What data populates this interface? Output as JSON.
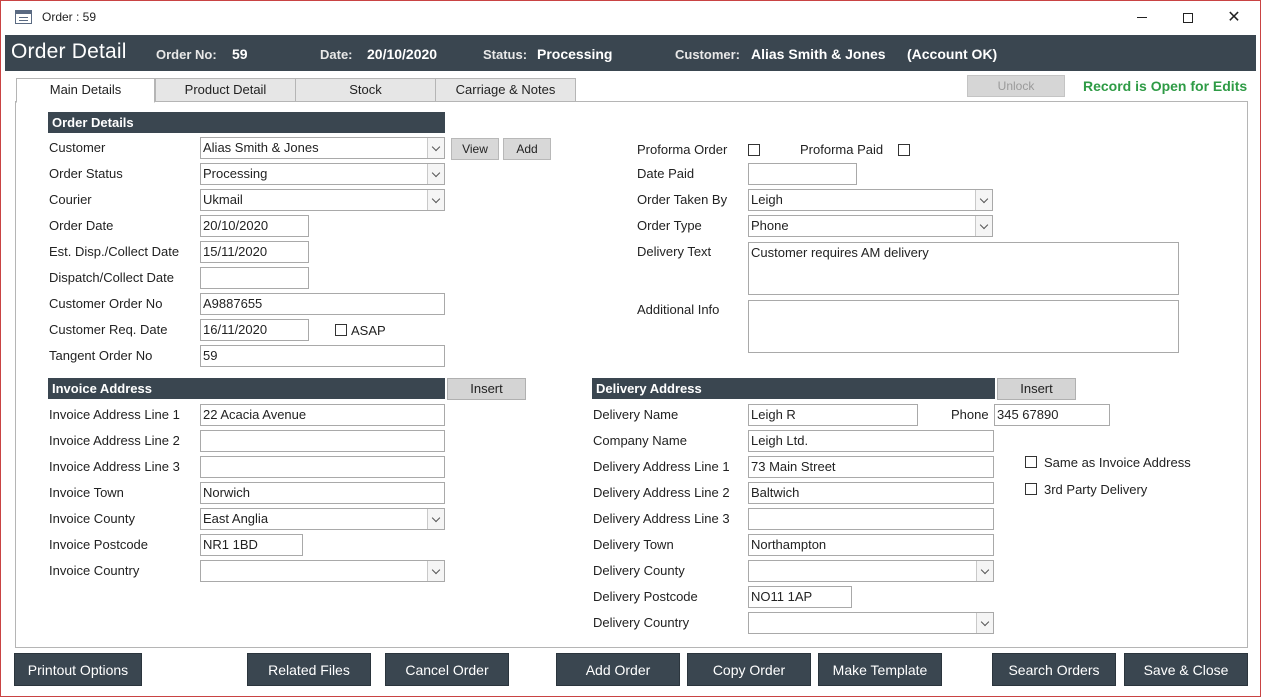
{
  "window": {
    "title": "Order : 59"
  },
  "header": {
    "heading": "Order Detail",
    "order_no_label": "Order No:",
    "order_no": "59",
    "date_label": "Date:",
    "date": "20/10/2020",
    "status_label": "Status:",
    "status": "Processing",
    "customer_label": "Customer:",
    "customer": "Alias Smith & Jones",
    "account_status": "(Account OK)"
  },
  "tabs": [
    {
      "label": "Main Details",
      "active": true
    },
    {
      "label": "Product Detail",
      "active": false
    },
    {
      "label": "Stock",
      "active": false
    },
    {
      "label": "Carriage & Notes",
      "active": false
    }
  ],
  "top_right": {
    "unlock_label": "Unlock",
    "record_status": "Record is Open for Edits"
  },
  "order_details": {
    "section_title": "Order Details",
    "customer_label": "Customer",
    "customer_value": "Alias Smith & Jones",
    "view_label": "View",
    "add_label": "Add",
    "order_status_label": "Order Status",
    "order_status_value": "Processing",
    "courier_label": "Courier",
    "courier_value": "Ukmail",
    "order_date_label": "Order Date",
    "order_date_value": "20/10/2020",
    "est_disp_label": "Est. Disp./Collect Date",
    "est_disp_value": "15/11/2020",
    "dispatch_label": "Dispatch/Collect Date",
    "dispatch_value": "",
    "cust_order_no_label": "Customer Order No",
    "cust_order_no_value": "A9887655",
    "cust_req_date_label": "Customer Req. Date",
    "cust_req_date_value": "16/11/2020",
    "asap_label": "ASAP",
    "tangent_order_label": "Tangent Order No",
    "tangent_order_value": "59"
  },
  "right_details": {
    "proforma_order_label": "Proforma Order",
    "proforma_paid_label": "Proforma Paid",
    "date_paid_label": "Date Paid",
    "date_paid_value": "",
    "order_taken_by_label": "Order Taken By",
    "order_taken_by_value": "Leigh",
    "order_type_label": "Order Type",
    "order_type_value": "Phone",
    "delivery_text_label": "Delivery Text",
    "delivery_text_value": "Customer requires AM delivery",
    "additional_info_label": "Additional Info",
    "additional_info_value": ""
  },
  "invoice_address": {
    "section_title": "Invoice Address",
    "insert_label": "Insert",
    "line1_label": "Invoice Address Line 1",
    "line1_value": "22 Acacia Avenue",
    "line2_label": "Invoice Address Line 2",
    "line2_value": "",
    "line3_label": "Invoice Address Line 3",
    "line3_value": "",
    "town_label": "Invoice Town",
    "town_value": "Norwich",
    "county_label": "Invoice County",
    "county_value": "East Anglia",
    "postcode_label": "Invoice Postcode",
    "postcode_value": "NR1 1BD",
    "country_label": "Invoice Country",
    "country_value": ""
  },
  "delivery_address": {
    "section_title": "Delivery Address",
    "insert_label": "Insert",
    "name_label": "Delivery Name",
    "name_value": "Leigh R",
    "phone_label": "Phone",
    "phone_value": "345 67890",
    "company_label": "Company Name",
    "company_value": "Leigh Ltd.",
    "line1_label": "Delivery Address Line 1",
    "line1_value": "73 Main Street",
    "line2_label": "Delivery Address Line 2",
    "line2_value": "Baltwich",
    "line3_label": "Delivery Address Line 3",
    "line3_value": "",
    "town_label": "Delivery Town",
    "town_value": "Northampton",
    "county_label": "Delivery County",
    "county_value": "",
    "postcode_label": "Delivery Postcode",
    "postcode_value": "NO11 1AP",
    "country_label": "Delivery Country",
    "country_value": "",
    "same_as_invoice_label": "Same as Invoice Address",
    "third_party_label": "3rd Party Delivery"
  },
  "footer": {
    "printout": "Printout Options",
    "related_files": "Related Files",
    "cancel_order": "Cancel Order",
    "add_order": "Add Order",
    "copy_order": "Copy Order",
    "make_template": "Make Template",
    "search_orders": "Search Orders",
    "save_close": "Save & Close"
  },
  "colors": {
    "header_bg": "#3a4650",
    "record_status": "#2e9b45",
    "window_border": "#c94343"
  }
}
